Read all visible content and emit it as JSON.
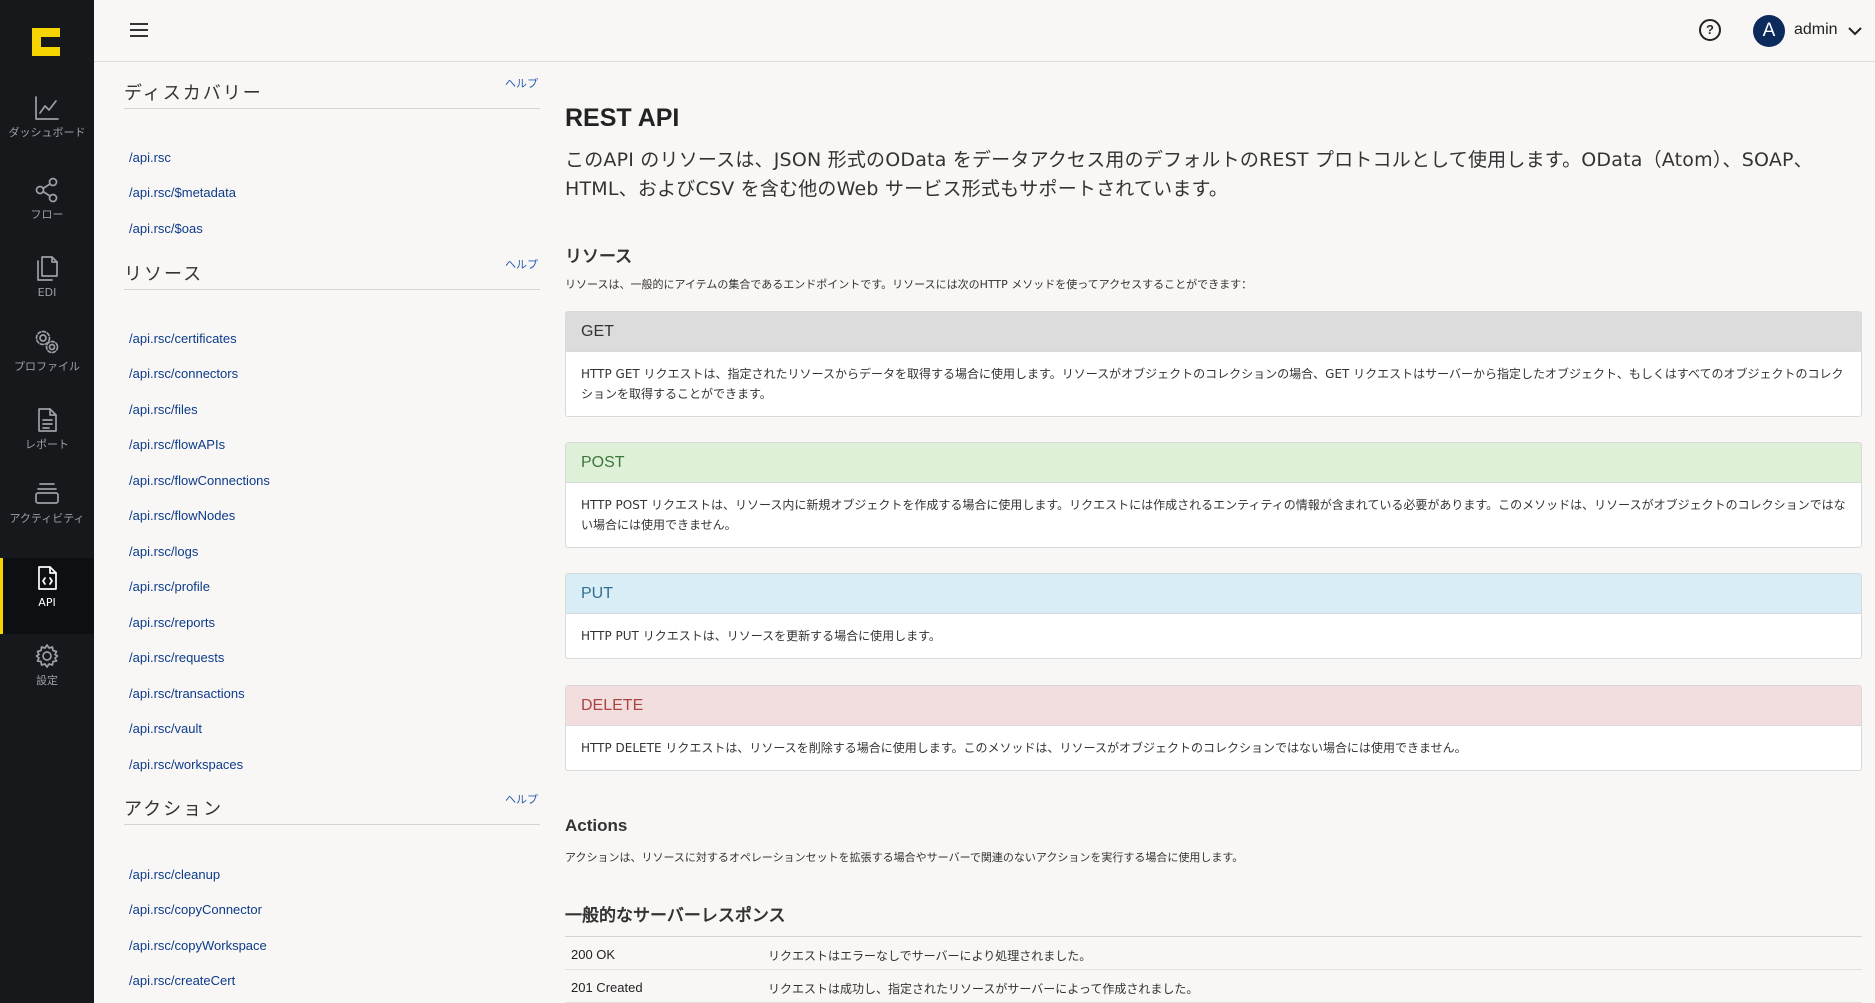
{
  "nav": {
    "items": [
      {
        "label": "ダッシュボード",
        "icon": "chart-line-icon"
      },
      {
        "label": "フロー",
        "icon": "share-nodes-icon"
      },
      {
        "label": "EDI",
        "icon": "documents-icon"
      },
      {
        "label": "プロファイル",
        "icon": "gears-icon"
      },
      {
        "label": "レポート",
        "icon": "report-file-icon"
      },
      {
        "label": "アクティビティ",
        "icon": "layers-icon"
      },
      {
        "label": "API",
        "icon": "api-file-icon",
        "active": true
      },
      {
        "label": "設定",
        "icon": "settings-gear-icon"
      }
    ]
  },
  "topbar": {
    "help_icon": "question-circle-icon",
    "avatar_initial": "A",
    "user_name": "admin"
  },
  "sidebar": {
    "discovery": {
      "title": "ディスカバリー",
      "help": "ヘルプ",
      "items": [
        "/api.rsc",
        "/api.rsc/$metadata",
        "/api.rsc/$oas"
      ]
    },
    "resources": {
      "title": "リソース",
      "help": "ヘルプ",
      "items": [
        "/api.rsc/certificates",
        "/api.rsc/connectors",
        "/api.rsc/files",
        "/api.rsc/flowAPIs",
        "/api.rsc/flowConnections",
        "/api.rsc/flowNodes",
        "/api.rsc/logs",
        "/api.rsc/profile",
        "/api.rsc/reports",
        "/api.rsc/requests",
        "/api.rsc/transactions",
        "/api.rsc/vault",
        "/api.rsc/workspaces"
      ]
    },
    "actions": {
      "title": "アクション",
      "help": "ヘルプ",
      "items": [
        "/api.rsc/cleanup",
        "/api.rsc/copyConnector",
        "/api.rsc/copyWorkspace",
        "/api.rsc/createCert"
      ]
    }
  },
  "main": {
    "title": "REST API",
    "intro": "このAPI のリソースは、JSON 形式のOData をデータアクセス用のデフォルトのREST プロトコルとして使用します。OData（Atom）、SOAP、HTML、およびCSV を含む他のWeb サービス形式もサポートされています。",
    "resources_title": "リソース",
    "resources_desc": "リソースは、一般的にアイテムの集合であるエンドポイントです。リソースには次のHTTP メソッドを使ってアクセスすることができます：",
    "methods": [
      {
        "name": "GET",
        "head_bg": "#dcdcdc",
        "head_color": "#333333",
        "desc": "HTTP GET リクエストは、指定されたリソースからデータを取得する場合に使用します。リソースがオブジェクトのコレクションの場合、GET リクエストはサーバーから指定したオブジェクト、もしくはすべてのオブジェクトのコレクションを取得することができます。"
      },
      {
        "name": "POST",
        "head_bg": "#dff0d8",
        "head_color": "#3c763d",
        "desc": "HTTP POST リクエストは、リソース内に新規オブジェクトを作成する場合に使用します。リクエストには作成されるエンティティの情報が含まれている必要があります。このメソッドは、リソースがオブジェクトのコレクションではない場合には使用できません。"
      },
      {
        "name": "PUT",
        "head_bg": "#d9edf7",
        "head_color": "#31708f",
        "desc": "HTTP PUT リクエストは、リソースを更新する場合に使用します。"
      },
      {
        "name": "DELETE",
        "head_bg": "#f2dede",
        "head_color": "#a94442",
        "desc": "HTTP DELETE リクエストは、リソースを削除する場合に使用します。このメソッドは、リソースがオブジェクトのコレクションではない場合には使用できません。"
      }
    ],
    "actions_title": "Actions",
    "actions_desc": "アクションは、リソースに対するオペレーションセットを拡張する場合やサーバーで関連のないアクションを実行する場合に使用します。",
    "responses_title": "一般的なサーバーレスポンス",
    "responses": [
      {
        "code": "200 OK",
        "text": "リクエストはエラーなしでサーバーにより処理されました。"
      },
      {
        "code": "201 Created",
        "text": "リクエストは成功し、指定されたリソースがサーバーによって作成されました。"
      }
    ]
  },
  "colors": {
    "rail_bg": "#16181c",
    "accent": "#f5d400",
    "link": "#0c3b8a",
    "avatar_bg": "#0d2a5c"
  }
}
